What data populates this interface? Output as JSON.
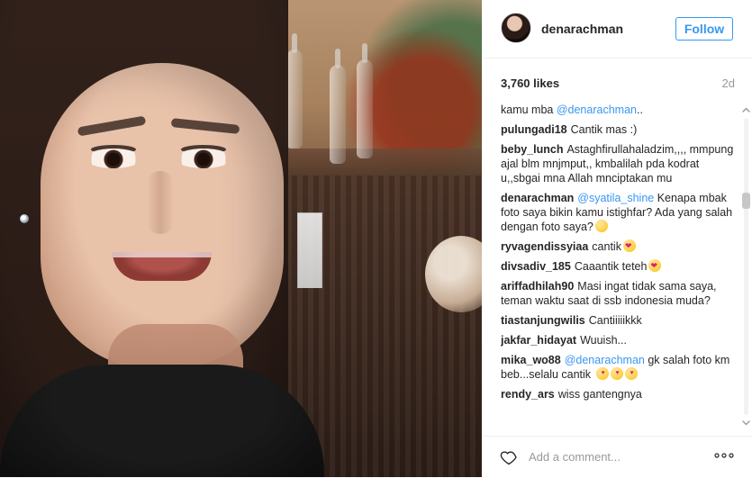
{
  "post": {
    "author": {
      "username": "denarachman"
    },
    "follow_label": "Follow",
    "likes": "3,760 likes",
    "age": "2d",
    "comments": [
      {
        "user": "",
        "text": "kamu mba ",
        "mention": "@denarachman",
        "after": ".."
      },
      {
        "user": "pulungadi18",
        "text": "Cantik mas :)"
      },
      {
        "user": "beby_lunch",
        "text": "Astaghfirullahaladzim,,,, mmpung ajal blm mnjmput,, kmbalilah pda kodrat u,,sbgai mna Allah mnciptakan mu"
      },
      {
        "user": "denarachman",
        "text": " Kenapa mbak foto saya bikin kamu istighfar? Ada yang salah dengan foto saya?",
        "mention": "@syatila_shine",
        "emoji": "smile"
      },
      {
        "user": "ryvagendissyiaa",
        "text": "cantik",
        "emoji": "heart-eyes"
      },
      {
        "user": "divsadiv_185",
        "text": "Caaantik teteh",
        "emoji": "heart-eyes"
      },
      {
        "user": "ariffadhilah90",
        "text": "Masi ingat tidak sama saya, teman waktu saat di ssb indonesia muda?"
      },
      {
        "user": "tiastanjungwilis",
        "text": "Cantiiiiikkk"
      },
      {
        "user": "jakfar_hidayat",
        "text": "Wuuish..."
      },
      {
        "user": "mika_wo88",
        "mention": "@denarachman",
        "text": " gk salah foto km beb...selalu cantik",
        "emoji": "kiss3"
      },
      {
        "user": "rendy_ars",
        "text": "wiss gantengnya"
      }
    ],
    "add_comment_placeholder": "Add a comment...",
    "icons": {
      "like": "heart-icon",
      "more": "more-options-icon"
    }
  }
}
